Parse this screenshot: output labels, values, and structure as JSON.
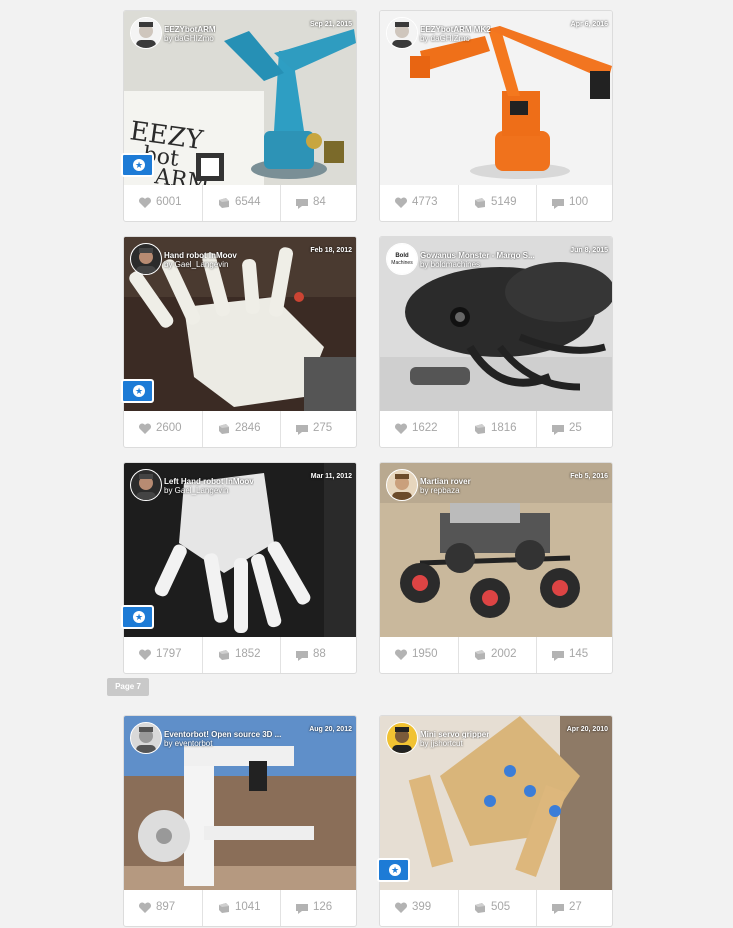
{
  "page_label": "Page 7",
  "cards": [
    {
      "title": "EEZYbotARM",
      "author": "daGHIZmo",
      "date": "Sep 21, 2015",
      "likes": "6001",
      "collects": "6544",
      "comments": "84",
      "featured": true
    },
    {
      "title": "EEZYbotARM MK2",
      "author": "daGHIZmo",
      "date": "Apr 6, 2016",
      "likes": "4773",
      "collects": "5149",
      "comments": "100",
      "featured": false
    },
    {
      "title": "Hand robot InMoov",
      "author": "Gael_Langevin",
      "date": "Feb 18, 2012",
      "likes": "2600",
      "collects": "2846",
      "comments": "275",
      "featured": true
    },
    {
      "title": "Gowanus Monster - Margo S...",
      "author": "boldmachines",
      "date": "Jun 8, 2015",
      "likes": "1622",
      "collects": "1816",
      "comments": "25",
      "featured": false
    },
    {
      "title": "Left Hand robot InMoov",
      "author": "Gael_Langevin",
      "date": "Mar 11, 2012",
      "likes": "1797",
      "collects": "1852",
      "comments": "88",
      "featured": true
    },
    {
      "title": "Martian rover",
      "author": "repbaza",
      "date": "Feb 5, 2016",
      "likes": "1950",
      "collects": "2002",
      "comments": "145",
      "featured": false
    },
    {
      "title": "Eventorbot! Open source 3D ...",
      "author": "eventorbot",
      "date": "Aug 20, 2012",
      "likes": "897",
      "collects": "1041",
      "comments": "126",
      "featured": false
    },
    {
      "title": "Mini servo gripper",
      "author": "jjshortcut",
      "date": "Apr 20, 2010",
      "likes": "399",
      "collects": "505",
      "comments": "27",
      "featured": true
    }
  ],
  "by_prefix": "by ",
  "avatar_texts": {
    "boldmachines": "Bold Machines"
  },
  "image_texts": {
    "eezybotarm_sign": "EEZY bot ARM"
  },
  "icons": {
    "like": "heart-icon",
    "collect": "collect-icon",
    "comment": "comment-icon",
    "featured": "star-badge-icon"
  },
  "colors": {
    "featured_badge": "#1d7bd6",
    "stat_text": "#a7a7a7",
    "page_label_bg": "#c9c9c9"
  }
}
